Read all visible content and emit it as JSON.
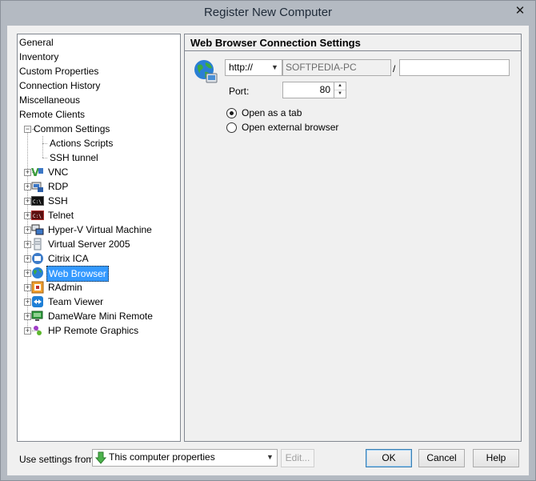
{
  "window": {
    "title": "Register New Computer",
    "close_glyph": "✕"
  },
  "tree": {
    "items": [
      {
        "label": "General"
      },
      {
        "label": "Inventory"
      },
      {
        "label": "Custom Properties"
      },
      {
        "label": "Connection History"
      },
      {
        "label": "Miscellaneous"
      },
      {
        "label": "Remote Clients"
      },
      {
        "label": "Common Settings"
      },
      {
        "label": "Actions Scripts"
      },
      {
        "label": "SSH tunnel"
      },
      {
        "label": "VNC",
        "icon": "vnc-icon"
      },
      {
        "label": "RDP",
        "icon": "rdp-icon"
      },
      {
        "label": "SSH",
        "icon": "ssh-terminal-icon"
      },
      {
        "label": "Telnet",
        "icon": "telnet-terminal-icon"
      },
      {
        "label": "Hyper-V Virtual Machine",
        "icon": "hyper-v-icon"
      },
      {
        "label": "Virtual Server 2005",
        "icon": "virtual-server-icon"
      },
      {
        "label": "Citrix ICA",
        "icon": "citrix-icon"
      },
      {
        "label": "Web Browser",
        "icon": "globe-icon",
        "selected": true
      },
      {
        "label": "RAdmin",
        "icon": "radmin-icon"
      },
      {
        "label": "Team Viewer",
        "icon": "teamviewer-icon"
      },
      {
        "label": "DameWare Mini Remote",
        "icon": "dameware-icon"
      },
      {
        "label": "HP Remote Graphics",
        "icon": "hp-rgs-icon"
      }
    ]
  },
  "settings": {
    "header": "Web Browser Connection Settings",
    "protocol": "http://",
    "host": "SOFTPEDIA-PC",
    "slash": "/",
    "path": "",
    "port_label": "Port:",
    "port_value": "80",
    "radio_tab": "Open as a tab",
    "radio_external": "Open external browser",
    "selected_mode": "tab"
  },
  "footer": {
    "use_settings_label": "Use settings from:",
    "use_settings_value": "This computer properties",
    "edit_label": "Edit...",
    "ok_label": "OK",
    "cancel_label": "Cancel",
    "help_label": "Help"
  },
  "colors": {
    "selection": "#3399ff",
    "titlebar": "#b4bac2",
    "dialog_bg": "#f0f0f0"
  }
}
